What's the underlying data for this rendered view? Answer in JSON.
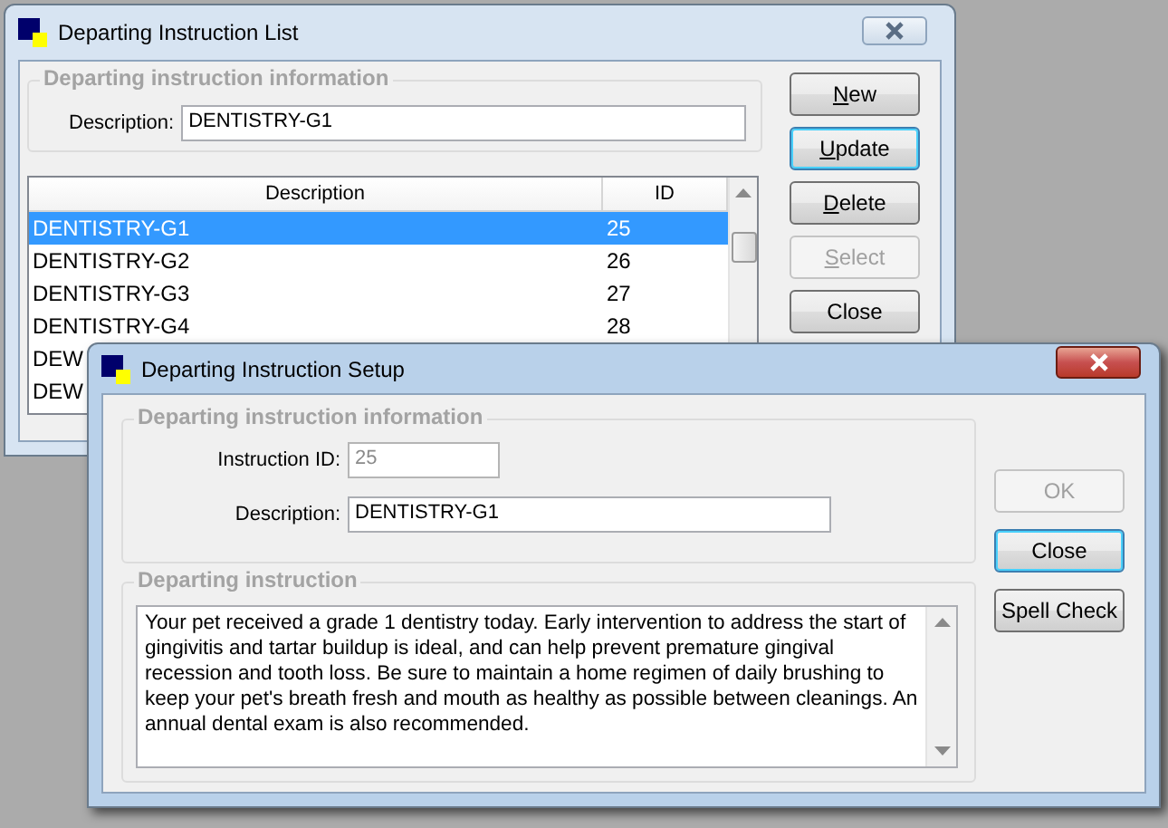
{
  "background_window": {
    "title": "Departing Instruction List",
    "active": false,
    "info_group": {
      "legend": "Departing instruction information",
      "description_label": "Description:",
      "description_value": "DENTISTRY-G1"
    },
    "list": {
      "columns": [
        "Description",
        "ID"
      ],
      "rows": [
        {
          "description": "DENTISTRY-G1",
          "id": "25",
          "selected": true
        },
        {
          "description": "DENTISTRY-G2",
          "id": "26",
          "selected": false
        },
        {
          "description": "DENTISTRY-G3",
          "id": "27",
          "selected": false
        },
        {
          "description": "DENTISTRY-G4",
          "id": "28",
          "selected": false
        },
        {
          "description": "DEW",
          "selected": false
        },
        {
          "description": "DEW",
          "selected": false
        }
      ]
    },
    "buttons": [
      {
        "label": "New",
        "disabled": false,
        "focused": false,
        "underline_first": true
      },
      {
        "label": "Update",
        "disabled": false,
        "focused": true,
        "underline_first": true
      },
      {
        "label": "Delete",
        "disabled": false,
        "focused": false,
        "underline_first": true
      },
      {
        "label": "Select",
        "disabled": true,
        "focused": false,
        "underline_first": true
      },
      {
        "label": "Close",
        "disabled": false,
        "focused": false,
        "underline_first": false
      }
    ]
  },
  "dialog": {
    "title": "Departing Instruction Setup",
    "active": true,
    "info_group": {
      "legend": "Departing instruction information",
      "id_label": "Instruction ID:",
      "id_value": "25",
      "id_disabled": true,
      "description_label": "Description:",
      "description_value": "DENTISTRY-G1"
    },
    "instruction_group": {
      "legend": "Departing instruction",
      "text": "Your pet received a grade 1 dentistry today. Early intervention to address the start of gingivitis and tartar buildup is ideal, and can help prevent premature gingival recession and tooth loss. Be sure to maintain a home regimen of daily brushing to keep your pet's breath fresh and mouth as healthy as possible between cleanings. An annual dental exam is also recommended."
    },
    "buttons": [
      {
        "label": "OK",
        "disabled": true,
        "focused": false
      },
      {
        "label": "Close",
        "disabled": false,
        "focused": true
      },
      {
        "label": "Spell Check",
        "disabled": false,
        "focused": false
      }
    ]
  }
}
